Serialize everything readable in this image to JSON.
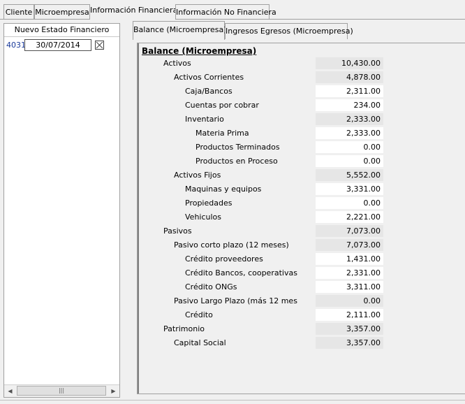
{
  "top_tabs": [
    "Cliente",
    "Microempresa",
    "Información Financiera",
    "Información No Financiera"
  ],
  "left_panel": {
    "header": "Nuevo Estado Financiero",
    "record_id": "4031",
    "record_date": "30/07/2014"
  },
  "inner_tabs": [
    "Balance (Microempresa)",
    "Ingresos Egresos (Microempresa)"
  ],
  "balance": {
    "title": "Balance (Microempresa)",
    "rows": [
      {
        "label": "Activos",
        "value": "10,430.00"
      },
      {
        "label": "Activos Corrientes",
        "value": "4,878.00"
      },
      {
        "label": "Caja/Bancos",
        "value": "2,311.00"
      },
      {
        "label": "Cuentas por cobrar",
        "value": "234.00"
      },
      {
        "label": "Inventario",
        "value": "2,333.00"
      },
      {
        "label": "Materia Prima",
        "value": "2,333.00"
      },
      {
        "label": "Productos Terminados",
        "value": "0.00"
      },
      {
        "label": "Productos en Proceso",
        "value": "0.00"
      },
      {
        "label": "Activos Fijos",
        "value": "5,552.00"
      },
      {
        "label": "Maquinas y equipos",
        "value": "3,331.00"
      },
      {
        "label": "Propiedades",
        "value": "0.00"
      },
      {
        "label": "Vehiculos",
        "value": "2,221.00"
      },
      {
        "label": "Pasivos",
        "value": "7,073.00"
      },
      {
        "label": "Pasivo corto plazo (12 meses)",
        "value": "7,073.00"
      },
      {
        "label": "Crédito proveedores",
        "value": "1,431.00"
      },
      {
        "label": "Crédito Bancos, cooperativas",
        "value": "2,331.00"
      },
      {
        "label": "Crédito ONGs",
        "value": "3,311.00"
      },
      {
        "label": "Pasivo Largo Plazo (más 12 mes",
        "value": "0.00"
      },
      {
        "label": "Crédito",
        "value": "2,111.00"
      },
      {
        "label": "Patrimonio",
        "value": "3,357.00"
      },
      {
        "label": "Capital Social",
        "value": "3,357.00"
      }
    ]
  }
}
